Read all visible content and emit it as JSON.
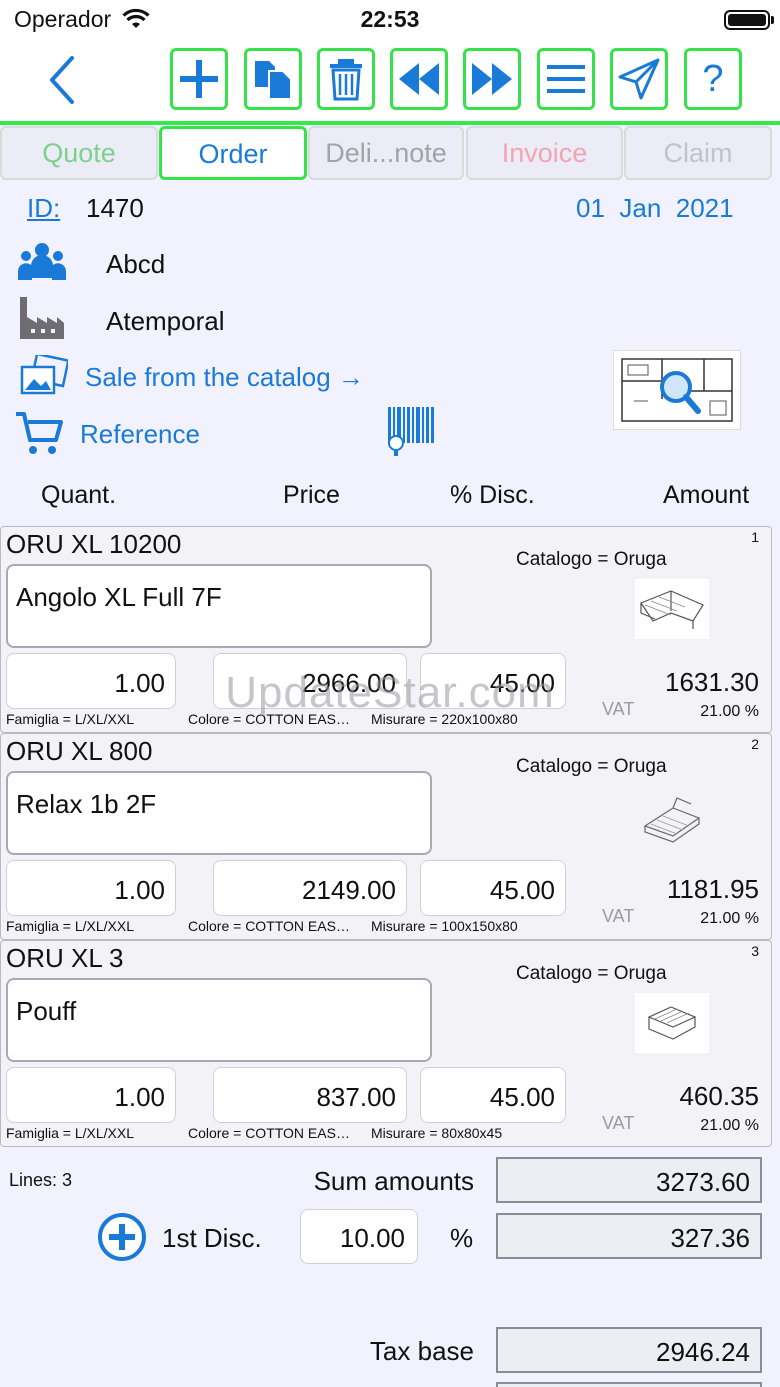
{
  "status_bar": {
    "carrier": "Operador",
    "time": "22:53"
  },
  "toolbar": {
    "back_icon": "chevron-left-icon",
    "buttons": [
      "plus-icon",
      "copy-icon",
      "trash-icon",
      "rewind-icon",
      "fast-forward-icon",
      "menu-icon",
      "send-icon",
      "help-icon"
    ],
    "help_label": "?",
    "accent_color": "#35e24a"
  },
  "tabs": [
    {
      "label": "Quote",
      "color": "#7fcf8f"
    },
    {
      "label": "Order",
      "color": "#1a7ad8"
    },
    {
      "label": "Deli...note",
      "color": "#a2a2aa"
    },
    {
      "label": "Invoice",
      "color": "#f4a3b0"
    },
    {
      "label": "Claim",
      "color": "#c2c2c8"
    }
  ],
  "header": {
    "id_label": "ID:",
    "id_value": "1470",
    "date": "01  Jan  2021",
    "customer": "Abcd",
    "supplier": "Atemporal",
    "catalog_link": "Sale from the catalog →",
    "reference_label": "Reference"
  },
  "columns": {
    "quant": "Quant.",
    "price": "Price",
    "disc": "% Disc.",
    "amount": "Amount"
  },
  "items": [
    {
      "code": "ORU XL 10200",
      "num": "1",
      "catalog": "Catalogo = Oruga",
      "desc": "Angolo XL Full 7F",
      "qty": "1.00",
      "price": "2966.00",
      "disc": "45.00",
      "amount": "1631.30",
      "vat_label": "VAT",
      "vat": "21.00 %",
      "famiglia": "Famiglia = L/XL/XXL",
      "colore": "Colore = COTTON EAS…",
      "misurare": "Misurare = 220x100x80"
    },
    {
      "code": "ORU XL 800",
      "num": "2",
      "catalog": "Catalogo = Oruga",
      "desc": "Relax 1b 2F",
      "qty": "1.00",
      "price": "2149.00",
      "disc": "45.00",
      "amount": "1181.95",
      "vat_label": "VAT",
      "vat": "21.00 %",
      "famiglia": "Famiglia = L/XL/XXL",
      "colore": "Colore = COTTON EAS…",
      "misurare": "Misurare = 100x150x80"
    },
    {
      "code": "ORU XL 3",
      "num": "3",
      "catalog": "Catalogo = Oruga",
      "desc": "Pouff",
      "qty": "1.00",
      "price": "837.00",
      "disc": "45.00",
      "amount": "460.35",
      "vat_label": "VAT",
      "vat": "21.00 %",
      "famiglia": "Famiglia = L/XL/XXL",
      "colore": "Colore = COTTON EAS…",
      "misurare": "Misurare = 80x80x45"
    }
  ],
  "totals": {
    "lines": "Lines: 3",
    "sum_label": "Sum amounts",
    "sum_value": "3273.60",
    "disc_label": "1st Disc.",
    "disc_pct": "10.00",
    "pct_sign": "%",
    "disc_value": "327.36",
    "tax_label": "Tax base",
    "tax_value": "2946.24"
  },
  "watermark": "UpdateStar.com"
}
